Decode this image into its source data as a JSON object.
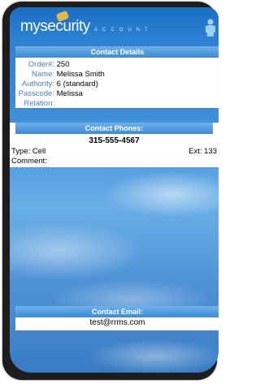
{
  "app": {
    "logo_my": "my",
    "logo_security": "security",
    "logo_account": "ACCOUNT"
  },
  "contact_details": {
    "title": "Contact Details",
    "fields": [
      {
        "label": "Order#:",
        "value": "250"
      },
      {
        "label": "Name:",
        "value": "Melissa Smith"
      },
      {
        "label": "Authority:",
        "value": "6 (standard)"
      },
      {
        "label": "Passcode:",
        "value": "Melissa"
      },
      {
        "label": "Relation:",
        "value": ""
      }
    ]
  },
  "contact_phones": {
    "title": "Contact Phones:",
    "number": "315-555-4567",
    "type_label": "Type: Cell",
    "ext_label": "Ext: 133",
    "comment_label": "Comment:"
  },
  "contact_email": {
    "title": "Contact Email:",
    "email": "test@rrms.com"
  },
  "colors": {
    "header": "#1b6ec2",
    "panel_title": "#3c8bd6",
    "label": "#4a7fc4"
  },
  "icons": {
    "user": "person-icon",
    "badge": "badge-icon"
  }
}
